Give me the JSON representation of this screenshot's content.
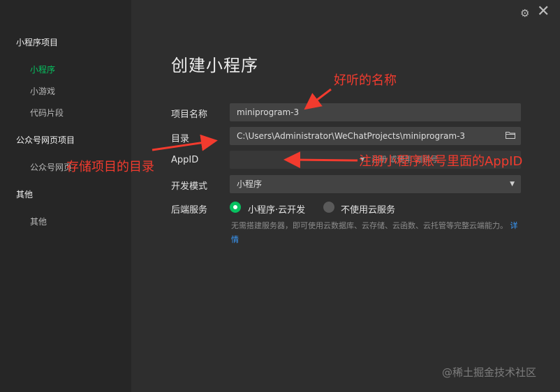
{
  "sidebar": {
    "sections": [
      {
        "title": "小程序项目",
        "items": [
          {
            "label": "小程序",
            "active": true
          },
          {
            "label": "小游戏",
            "active": false
          },
          {
            "label": "代码片段",
            "active": false
          }
        ]
      },
      {
        "title": "公众号网页项目",
        "items": [
          {
            "label": "公众号网页",
            "active": false
          }
        ]
      },
      {
        "title": "其他",
        "items": [
          {
            "label": "其他",
            "active": false
          }
        ]
      }
    ]
  },
  "window": {
    "settings_icon": "gear-icon",
    "close_icon": "close-icon"
  },
  "main": {
    "title": "创建小程序",
    "form": {
      "project_name": {
        "label": "项目名称",
        "value": "miniprogram-3"
      },
      "directory": {
        "label": "目录",
        "value": "C:\\Users\\Administrator\\WeChatProjects\\miniprogram-3",
        "icon": "folder-icon"
      },
      "appid": {
        "label": "AppID",
        "value": "",
        "link_text": "注册 或使用 测试号"
      },
      "dev_mode": {
        "label": "开发模式",
        "value": "小程序"
      },
      "backend": {
        "label": "后端服务",
        "options": [
          {
            "label": "小程序·云开发",
            "selected": true
          },
          {
            "label": "不使用云服务",
            "selected": false
          }
        ],
        "note": "无需搭建服务器，即可使用云数据库、云存储、云函数、云托管等完整云端能力。",
        "note_link": "详情"
      }
    }
  },
  "annotations": {
    "name_hint": "好听的名称",
    "dir_hint": "存储项目的目录",
    "appid_hint": "注册小程序账号里面的AppID"
  },
  "watermark": "@稀土掘金技术社区",
  "colors": {
    "accent": "#07c160",
    "link": "#3a9cff",
    "annotation": "#f23b2e"
  }
}
